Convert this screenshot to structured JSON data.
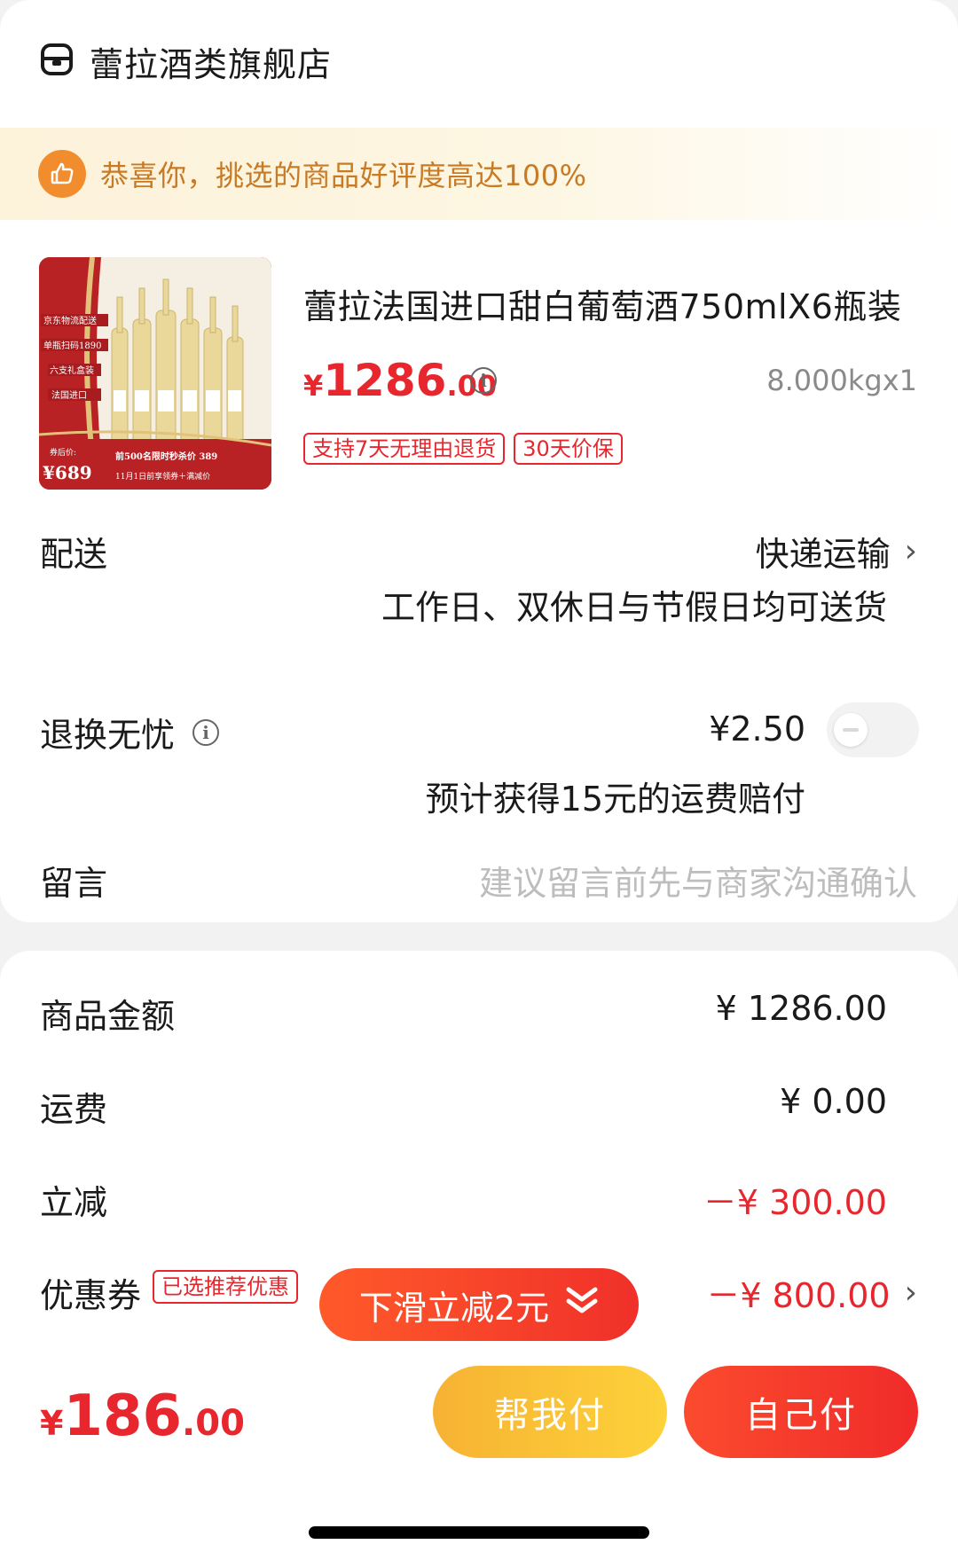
{
  "store": {
    "name": "蕾拉酒类旗舰店",
    "icon": "store-icon"
  },
  "banner": {
    "text": "恭喜你，挑选的商品好评度高达100%",
    "icon": "thumbs-up-icon"
  },
  "product": {
    "title": "蕾拉法国进口甜白葡萄酒750mlX6瓶装",
    "price_currency": "¥",
    "price_int": "1286",
    "price_dec": ".00",
    "weight_qty": "8.000kgx1",
    "tags": [
      "支持7天无理由退货",
      "30天价保"
    ],
    "image": {
      "labels": [
        "京东物流配送",
        "单瓶扫码1890",
        "六支礼盒装",
        "法国进口"
      ],
      "price_label": "券后价:",
      "price": "¥689",
      "promo_line1": "前500名限时秒杀价 389",
      "promo_line2": "11月1日前享领券＋满减价"
    }
  },
  "delivery": {
    "label": "配送",
    "value": "快递运输",
    "note": "工作日、双休日与节假日均可送货"
  },
  "returns": {
    "label": "退换无忧",
    "price": "¥2.50",
    "note": "预计获得15元的运费赔付",
    "toggle_on": false
  },
  "message": {
    "label": "留言",
    "placeholder": "建议留言前先与商家沟通确认"
  },
  "summary": {
    "goods_label": "商品金额",
    "goods_value": "¥ 1286.00",
    "shipping_label": "运费",
    "shipping_value": "¥ 0.00",
    "discount_label": "立减",
    "discount_value": "－¥ 300.00",
    "coupon_label": "优惠券",
    "coupon_tag": "已选推荐优惠",
    "coupon_value": "－¥ 800.00",
    "slide_hint": "下滑立减2元"
  },
  "footer": {
    "total_currency": "¥",
    "total_int": "186",
    "total_dec": ".00",
    "help_pay": "帮我付",
    "self_pay": "自己付"
  },
  "colors": {
    "accent_red": "#e8262d",
    "banner_text": "#c87a24",
    "help_yellow": "#f9c035"
  }
}
